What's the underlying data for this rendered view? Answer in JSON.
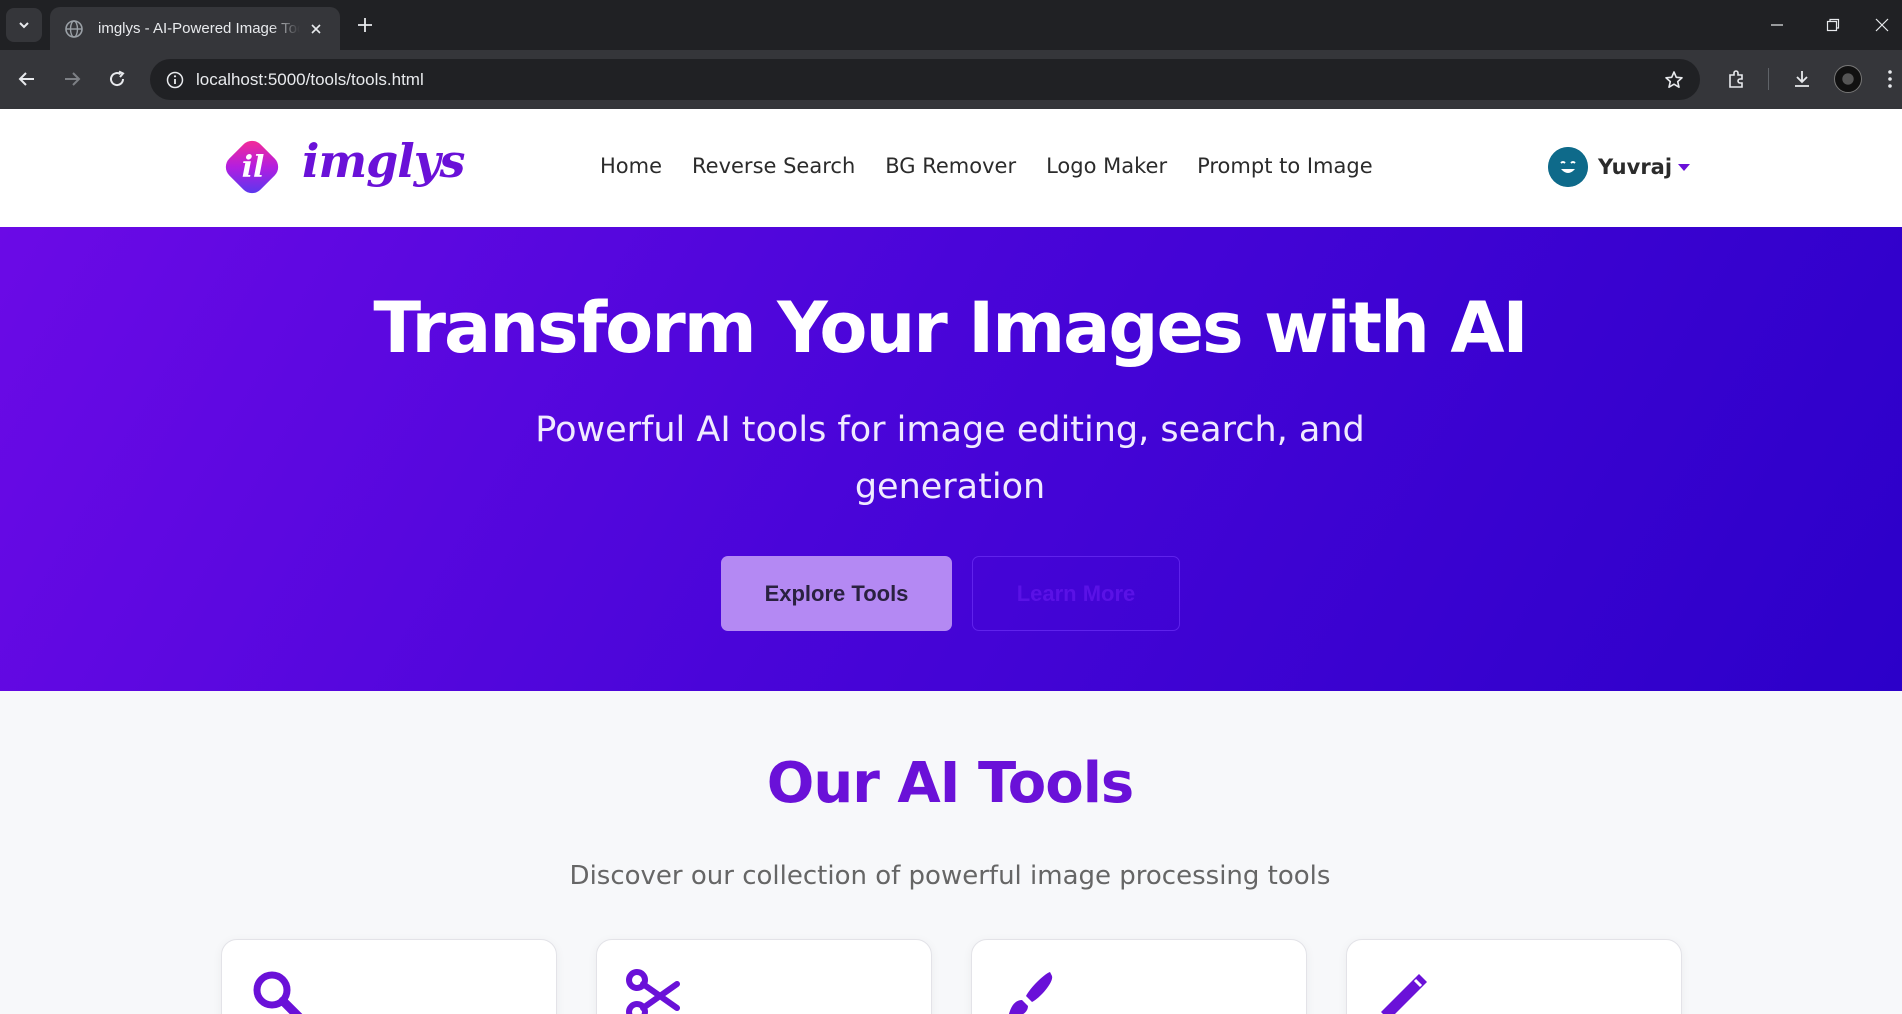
{
  "browser": {
    "tab_title": "imglys - AI-Powered Image Tools",
    "url": "localhost:5000/tools/tools.html"
  },
  "header": {
    "logo_text": "imglys",
    "nav": [
      "Home",
      "Reverse Search",
      "BG Remover",
      "Logo Maker",
      "Prompt to Image"
    ],
    "user_name": "Yuvraj"
  },
  "hero": {
    "title": "Transform Your Images with AI",
    "subtitle": "Powerful AI tools for image editing, search, and generation",
    "primary_button": "Explore Tools",
    "secondary_button": "Learn More"
  },
  "tools_section": {
    "title": "Our AI Tools",
    "subtitle": "Discover our collection of powerful image processing tools",
    "cards": [
      {
        "icon": "search-icon"
      },
      {
        "icon": "scissors-icon"
      },
      {
        "icon": "paint-brush-icon"
      },
      {
        "icon": "magic-wand-icon"
      }
    ]
  },
  "colors": {
    "brand_purple": "#6a11d8",
    "hero_gradient_start": "#6b0ae6",
    "hero_gradient_end": "#2c00c9",
    "explore_button": "#b489f3"
  }
}
